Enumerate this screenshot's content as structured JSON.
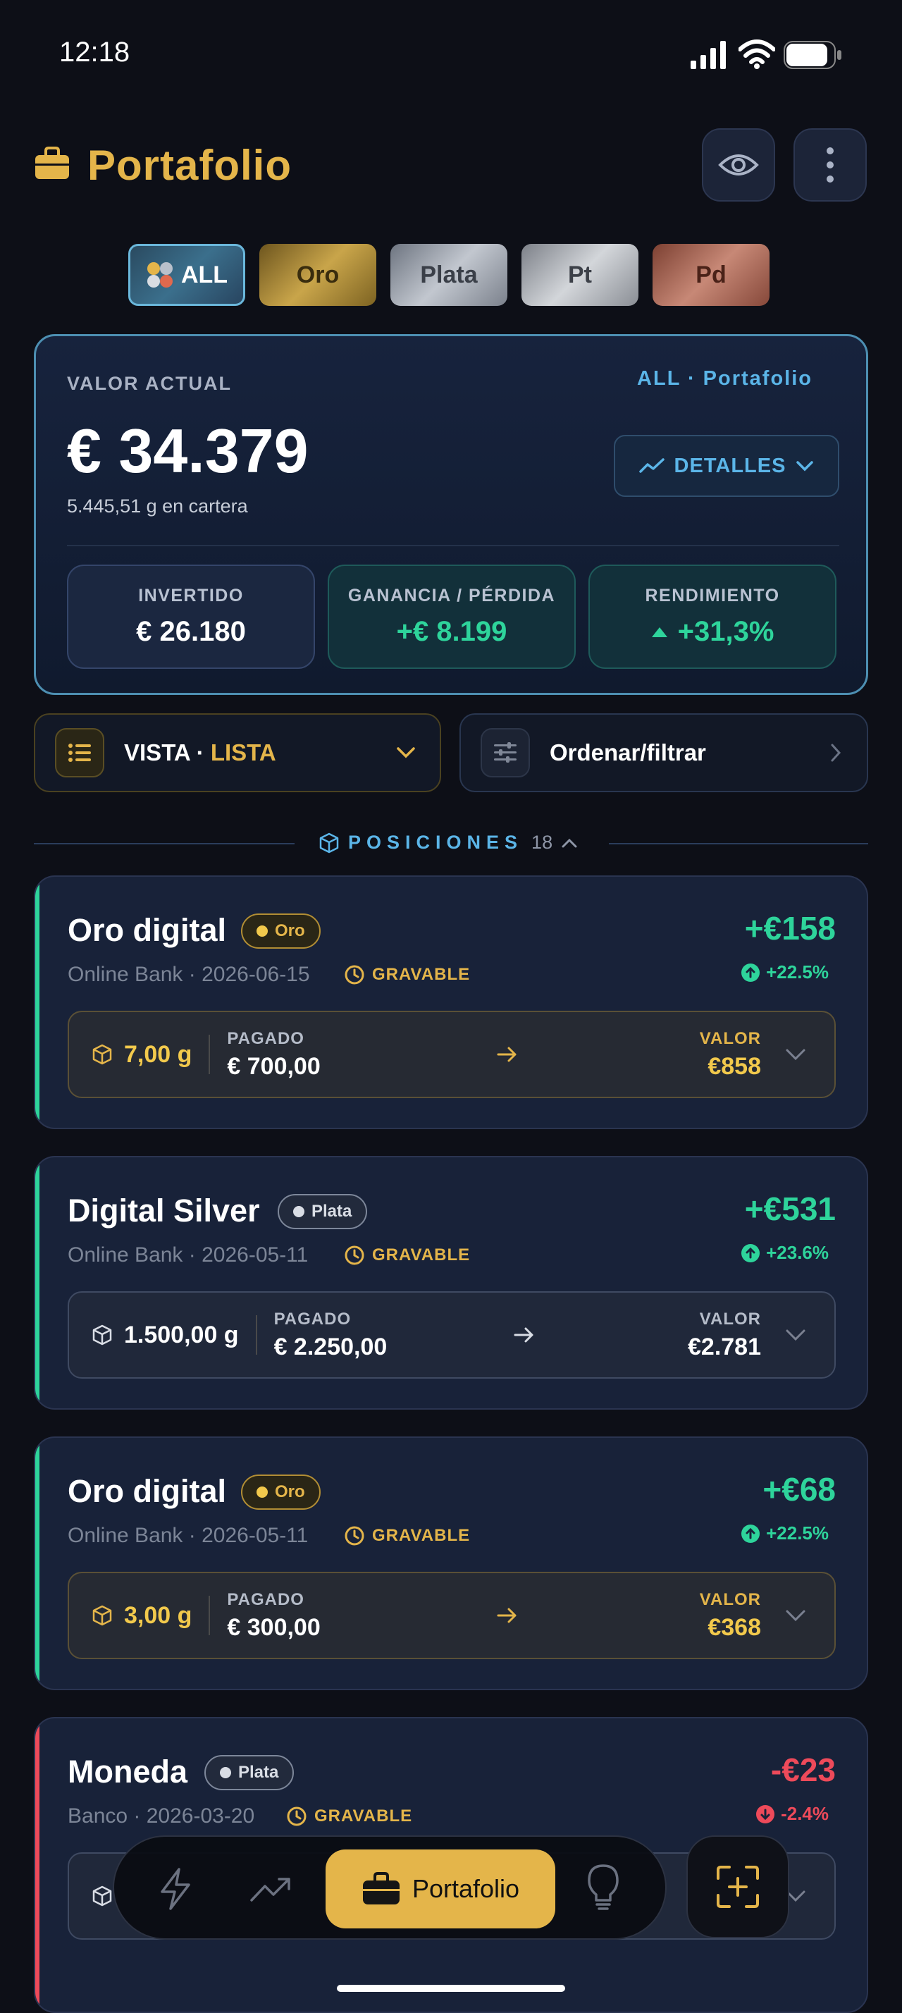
{
  "status_bar": {
    "time": "12:18"
  },
  "header": {
    "title": "Portafolio"
  },
  "metal_tabs": [
    {
      "label": "ALL"
    },
    {
      "label": "Oro"
    },
    {
      "label": "Plata"
    },
    {
      "label": "Pt"
    },
    {
      "label": "Pd"
    }
  ],
  "summary": {
    "label": "VALOR ACTUAL",
    "context": "ALL · Portafolio",
    "value": "€ 34.379",
    "grams": "5.445,51 g en cartera",
    "details_label": "DETALLES",
    "stats": [
      {
        "title": "INVERTIDO",
        "value": "€ 26.180"
      },
      {
        "title": "GANANCIA / PÉRDIDA",
        "value": "+€ 8.199"
      },
      {
        "title": "RENDIMIENTO",
        "value": "+31,3%"
      }
    ]
  },
  "view": {
    "prefix": "VISTA · ",
    "mode": "LISTA"
  },
  "order": {
    "label": "Ordenar/filtrar"
  },
  "positions": {
    "title": "POSICIONES",
    "count": "18"
  },
  "cards": [
    {
      "name": "Oro digital",
      "badge": "Oro",
      "meta": "Online Bank · 2026-06-15",
      "tax": "GRAVABLE",
      "pl": "+€158",
      "pct": "+22.5%",
      "grams": "7,00 g",
      "paid_label": "PAGADO",
      "paid": "€ 700,00",
      "value_label": "VALOR",
      "value": "€858"
    },
    {
      "name": "Digital Silver",
      "badge": "Plata",
      "meta": "Online Bank · 2026-05-11",
      "tax": "GRAVABLE",
      "pl": "+€531",
      "pct": "+23.6%",
      "grams": "1.500,00 g",
      "paid_label": "PAGADO",
      "paid": "€ 2.250,00",
      "value_label": "VALOR",
      "value": "€2.781"
    },
    {
      "name": "Oro digital",
      "badge": "Oro",
      "meta": "Online Bank · 2026-05-11",
      "tax": "GRAVABLE",
      "pl": "+€68",
      "pct": "+22.5%",
      "grams": "3,00 g",
      "paid_label": "PAGADO",
      "paid": "€ 300,00",
      "value_label": "VALOR",
      "value": "€368"
    },
    {
      "name": "Moneda",
      "badge": "Plata",
      "meta": "Banco · 2026-03-20",
      "tax": "GRAVABLE",
      "pl": "-€23",
      "pct": "-2.4%"
    }
  ],
  "nav": {
    "active_label": "Portafolio"
  },
  "colors": {
    "gold": "#e4b54a",
    "green": "#2ed49b",
    "red": "#ee4a5a",
    "blue": "#5bb5e8",
    "background": "#0d0f17"
  }
}
